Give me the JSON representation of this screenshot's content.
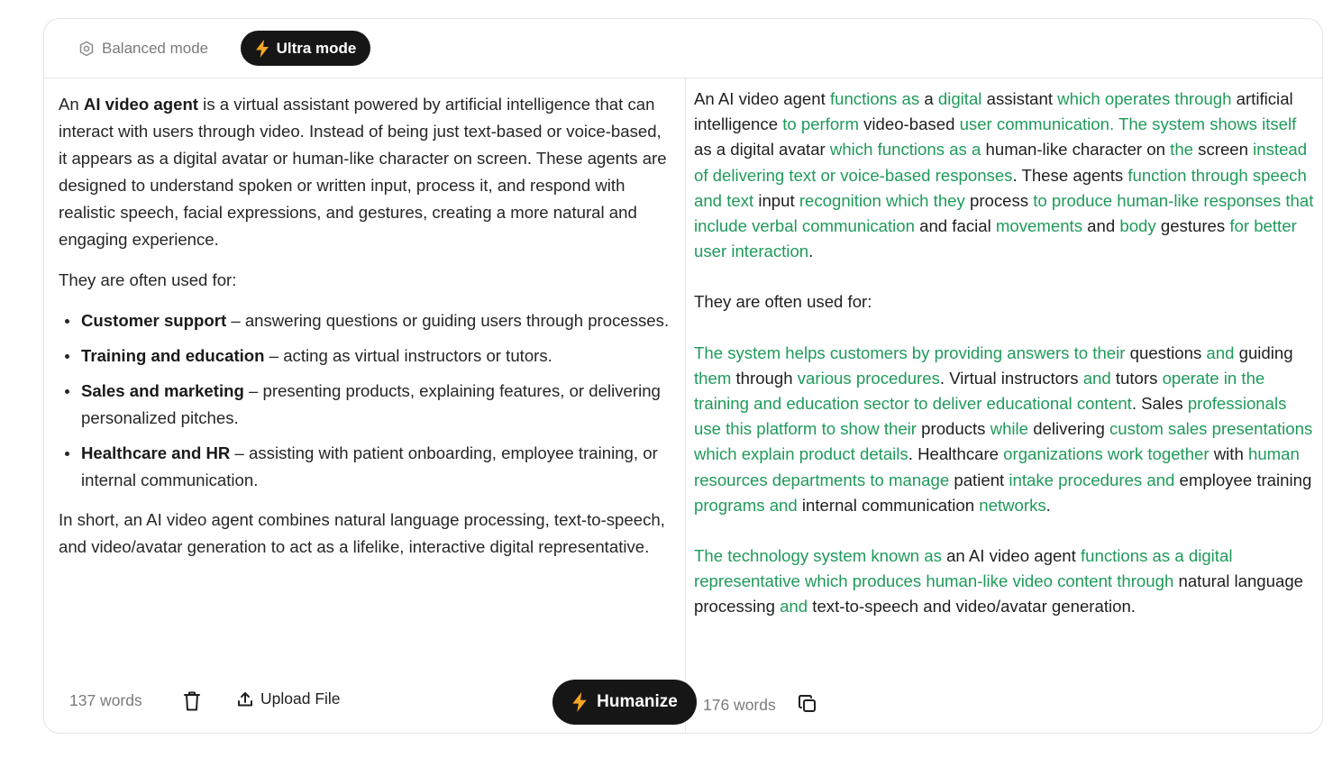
{
  "modes": {
    "balanced_label": "Balanced mode",
    "ultra_label": "Ultra mode"
  },
  "input": {
    "intro_bold": "AI video agent",
    "intro_pre": "An ",
    "intro_post": " is a virtual assistant powered by artificial intelligence that can interact with users through video. Instead of being just text-based or voice-based, it appears as a digital avatar or human-like character on screen. These agents are designed to understand spoken or written input, process it, and respond with realistic speech, facial expressions, and gestures, creating a more natural and engaging experience.",
    "used_for": "They are often used for:",
    "bullets": [
      {
        "title": "Customer support",
        "text": " – answering questions or guiding users through processes."
      },
      {
        "title": "Training and education",
        "text": " – acting as virtual instructors or tutors."
      },
      {
        "title": "Sales and marketing",
        "text": " – presenting products, explaining features, or delivering personalized pitches."
      },
      {
        "title": "Healthcare and HR",
        "text": " – assisting with patient onboarding, employee training, or internal communication."
      }
    ],
    "summary": "In short, an AI video agent combines natural language processing, text-to-speech, and video/avatar generation to act as a lifelike, interactive digital representative.",
    "word_count": "137 words",
    "upload_label": "Upload File",
    "humanize_label": "Humanize"
  },
  "output": {
    "paragraphs": [
      [
        {
          "t": "An AI video agent ",
          "c": false
        },
        {
          "t": "functions as",
          "c": true
        },
        {
          "t": " a ",
          "c": false
        },
        {
          "t": "digital",
          "c": true
        },
        {
          "t": " assistant ",
          "c": false
        },
        {
          "t": "which operates through",
          "c": true
        },
        {
          "t": " artificial intelligence ",
          "c": false
        },
        {
          "t": "to perform",
          "c": true
        },
        {
          "t": " video-based ",
          "c": false
        },
        {
          "t": "user communication. The system shows itself",
          "c": true
        },
        {
          "t": " as a digital avatar ",
          "c": false
        },
        {
          "t": "which functions as a",
          "c": true
        },
        {
          "t": " human-like character on ",
          "c": false
        },
        {
          "t": "the",
          "c": true
        },
        {
          "t": " screen ",
          "c": false
        },
        {
          "t": "instead of delivering text or voice-based responses",
          "c": true
        },
        {
          "t": ". These agents ",
          "c": false
        },
        {
          "t": "function through speech and text",
          "c": true
        },
        {
          "t": " input ",
          "c": false
        },
        {
          "t": "recognition which they",
          "c": true
        },
        {
          "t": " process ",
          "c": false
        },
        {
          "t": "to produce human-like responses that include verbal communication",
          "c": true
        },
        {
          "t": " and facial ",
          "c": false
        },
        {
          "t": "movements",
          "c": true
        },
        {
          "t": " and ",
          "c": false
        },
        {
          "t": "body",
          "c": true
        },
        {
          "t": " gestures ",
          "c": false
        },
        {
          "t": "for better user interaction",
          "c": true
        },
        {
          "t": ".",
          "c": false
        }
      ],
      [
        {
          "t": "They are often used for:",
          "c": false
        }
      ],
      [
        {
          "t": "The system helps customers by providing answers to their",
          "c": true
        },
        {
          "t": " questions ",
          "c": false
        },
        {
          "t": "and",
          "c": true
        },
        {
          "t": " guiding ",
          "c": false
        },
        {
          "t": "them",
          "c": true
        },
        {
          "t": " through ",
          "c": false
        },
        {
          "t": "various procedures",
          "c": true
        },
        {
          "t": ". Virtual instructors ",
          "c": false
        },
        {
          "t": "and",
          "c": true
        },
        {
          "t": " tutors ",
          "c": false
        },
        {
          "t": "operate in the training and education sector to deliver educational content",
          "c": true
        },
        {
          "t": ". Sales ",
          "c": false
        },
        {
          "t": "professionals use this platform to show their",
          "c": true
        },
        {
          "t": " products ",
          "c": false
        },
        {
          "t": "while",
          "c": true
        },
        {
          "t": " delivering ",
          "c": false
        },
        {
          "t": "custom sales presentations which explain product details",
          "c": true
        },
        {
          "t": ". Healthcare ",
          "c": false
        },
        {
          "t": "organizations work together",
          "c": true
        },
        {
          "t": " with ",
          "c": false
        },
        {
          "t": "human resources departments to manage",
          "c": true
        },
        {
          "t": " patient ",
          "c": false
        },
        {
          "t": "intake procedures and",
          "c": true
        },
        {
          "t": " employee training ",
          "c": false
        },
        {
          "t": "programs and",
          "c": true
        },
        {
          "t": " internal communication ",
          "c": false
        },
        {
          "t": "networks",
          "c": true
        },
        {
          "t": ".",
          "c": false
        }
      ],
      [
        {
          "t": "The technology system known as",
          "c": true
        },
        {
          "t": " an AI video agent ",
          "c": false
        },
        {
          "t": "functions as a digital representative which produces human-like video content through",
          "c": true
        },
        {
          "t": " natural language processing ",
          "c": false
        },
        {
          "t": "and",
          "c": true
        },
        {
          "t": " text-to-speech and video/avatar generation.",
          "c": false
        }
      ]
    ],
    "word_count": "176 words"
  },
  "colors": {
    "changed_text": "#1f9a5a",
    "dark_button": "#161616",
    "bolt": "#f5a623"
  },
  "icons": [
    "shield-icon",
    "bolt-icon",
    "trash-icon",
    "upload-icon",
    "copy-icon"
  ]
}
